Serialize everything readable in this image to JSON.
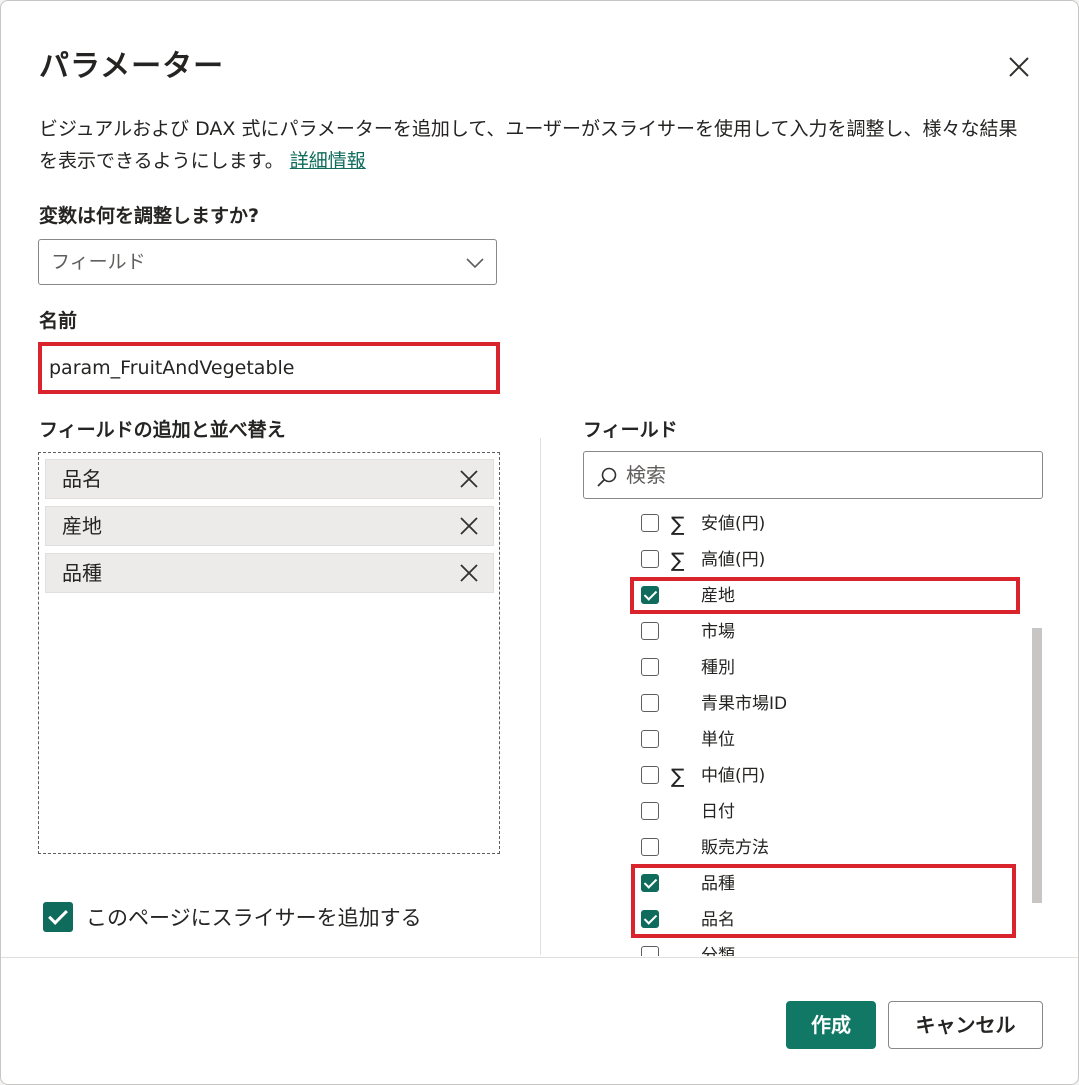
{
  "dialog": {
    "title": "パラメーター",
    "description": "ビジュアルおよび DAX 式にパラメーターを追加して、ユーザーがスライサーを使用して入力を調整し、様々な結果を表示できるようにします。",
    "learn_more": "詳細情報"
  },
  "variable": {
    "label": "変数は何を調整しますか?",
    "selected": "フィールド"
  },
  "name": {
    "label": "名前",
    "value": "param_FruitAndVegetable"
  },
  "selected_fields": {
    "label": "フィールドの追加と並べ替え",
    "items": [
      "品名",
      "産地",
      "品種"
    ]
  },
  "fields": {
    "label": "フィールド",
    "search_placeholder": "検索",
    "items": [
      {
        "label": "安値(円)",
        "measure": true,
        "checked": false
      },
      {
        "label": "高値(円)",
        "measure": true,
        "checked": false
      },
      {
        "label": "産地",
        "measure": false,
        "checked": true
      },
      {
        "label": "市場",
        "measure": false,
        "checked": false
      },
      {
        "label": "種別",
        "measure": false,
        "checked": false
      },
      {
        "label": "青果市場ID",
        "measure": false,
        "checked": false
      },
      {
        "label": "単位",
        "measure": false,
        "checked": false
      },
      {
        "label": "中値(円)",
        "measure": true,
        "checked": false
      },
      {
        "label": "日付",
        "measure": false,
        "checked": false
      },
      {
        "label": "販売方法",
        "measure": false,
        "checked": false
      },
      {
        "label": "品種",
        "measure": false,
        "checked": true
      },
      {
        "label": "品名",
        "measure": false,
        "checked": true
      },
      {
        "label": "分類",
        "measure": false,
        "checked": false
      }
    ]
  },
  "slicer_option": {
    "label": "このページにスライサーを追加する",
    "checked": true
  },
  "buttons": {
    "create": "作成",
    "cancel": "キャンセル"
  },
  "colors": {
    "accent": "#117865",
    "highlight": "#d9232d"
  }
}
